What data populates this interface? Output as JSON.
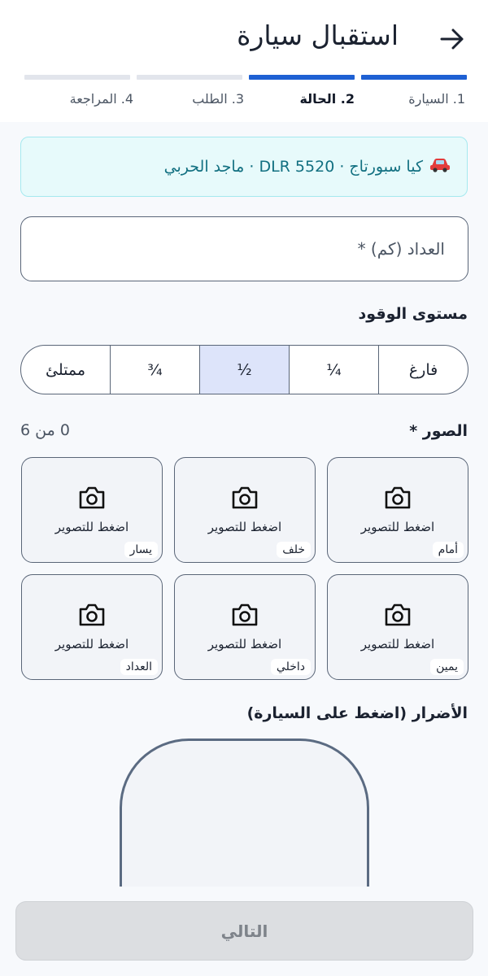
{
  "header": {
    "title": "استقبال سيارة",
    "back_icon": "arrow-right-icon"
  },
  "progress": {
    "total_steps": 4,
    "completed_steps": 2
  },
  "steps": [
    {
      "label": "1. السيارة",
      "active": false
    },
    {
      "label": "2. الحالة",
      "active": true
    },
    {
      "label": "3. الطلب",
      "active": false
    },
    {
      "label": "4. المراجعة",
      "active": false
    }
  ],
  "vehicle": {
    "icon": "car-icon",
    "summary": "كيا سبورتاج · DLR 5520 · ماجد الحربي"
  },
  "odometer": {
    "placeholder": "العداد (كم) *",
    "value": ""
  },
  "fuel": {
    "label": "مستوى الوقود",
    "options": [
      "فارغ",
      "¼",
      "½",
      "¾",
      "ممتلئ"
    ],
    "selected": "½"
  },
  "photos": {
    "label": "الصور *",
    "count": "0 من 6",
    "tap_label": "اضغط للتصوير",
    "camera_icon": "camera-icon",
    "tiles": [
      "أمام",
      "خلف",
      "يسار",
      "يمين",
      "داخلي",
      "العداد"
    ]
  },
  "damage": {
    "label": "الأضرار (اضغط على السيارة)"
  },
  "footer": {
    "next_label": "التالي",
    "enabled": false
  },
  "colors": {
    "primary": "#1e60d3",
    "banner_bg": "#e7fafb",
    "banner_text": "#127081",
    "selected_bg": "#dde4fa"
  }
}
